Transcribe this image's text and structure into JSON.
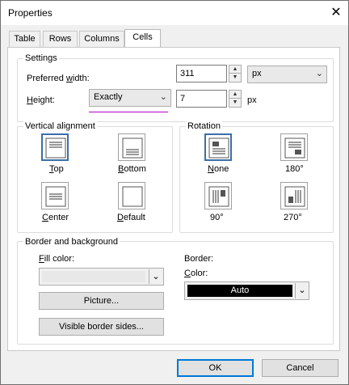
{
  "window": {
    "title": "Properties",
    "close_glyph": "✕"
  },
  "tabs": [
    {
      "label": "Table",
      "active": false
    },
    {
      "label": "Rows",
      "active": false
    },
    {
      "label": "Columns",
      "active": false
    },
    {
      "label": "Cells",
      "active": true
    }
  ],
  "settings": {
    "group_label": "Settings",
    "preferred_width_label": "Preferred width:",
    "preferred_width_value": "311",
    "preferred_width_unit": "px",
    "height_label": "Height:",
    "height_mode": "Exactly",
    "height_value": "7",
    "height_unit": "px"
  },
  "vertical_alignment": {
    "group_label": "Vertical alignment",
    "options": [
      {
        "label": "Top",
        "selected": true
      },
      {
        "label": "Bottom",
        "selected": false
      },
      {
        "label": "Center",
        "selected": false
      },
      {
        "label": "Default",
        "selected": false
      }
    ]
  },
  "rotation": {
    "group_label": "Rotation",
    "options": [
      {
        "label": "None",
        "selected": true
      },
      {
        "label": "180°",
        "selected": false
      },
      {
        "label": "90°",
        "selected": false
      },
      {
        "label": "270°",
        "selected": false
      }
    ]
  },
  "border_background": {
    "group_label": "Border and background",
    "fill_color_label": "Fill color:",
    "picture_button": "Picture...",
    "visible_border_sides_button": "Visible border sides...",
    "border_label": "Border:",
    "color_label": "Color:",
    "border_color_value": "Auto",
    "border_color_hex": "#000000"
  },
  "footer": {
    "ok_label": "OK",
    "cancel_label": "Cancel"
  }
}
